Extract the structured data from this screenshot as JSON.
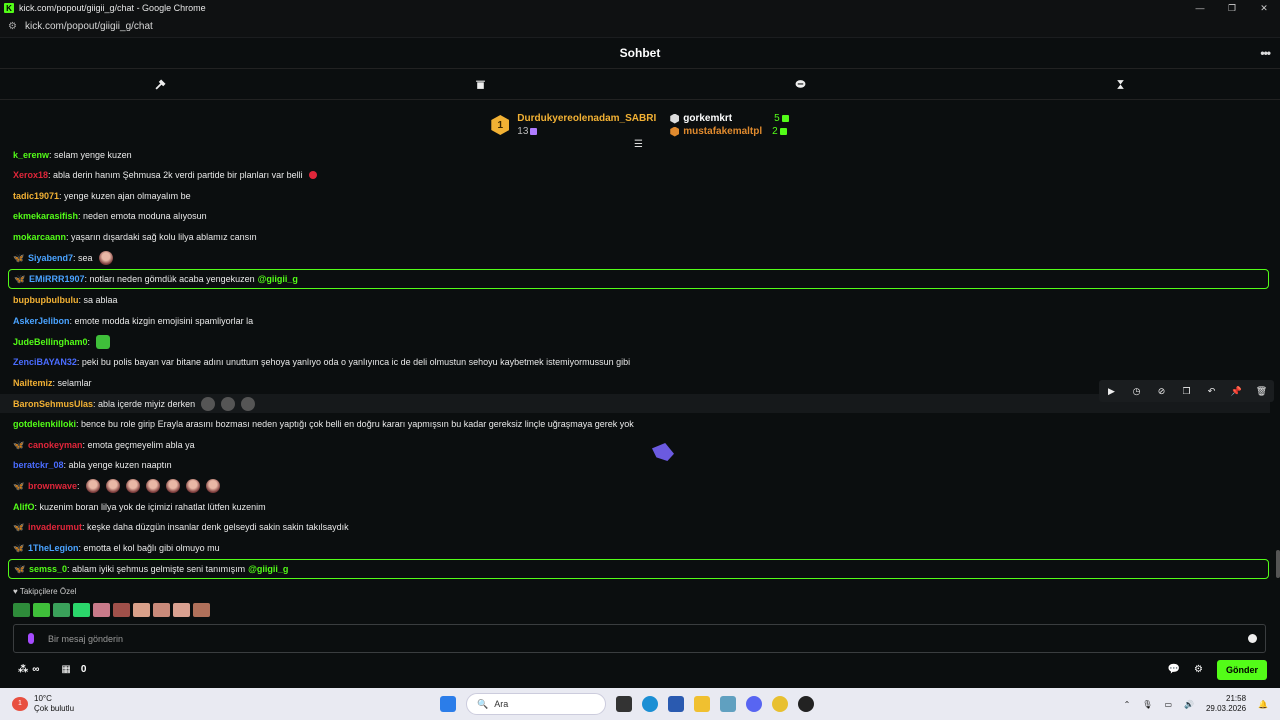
{
  "browser": {
    "title": "kick.com/popout/giigii_g/chat - Google Chrome",
    "url": "kick.com/popout/giigii_g/chat"
  },
  "header": {
    "title": "Sohbet",
    "more": "•••"
  },
  "leaderboard": {
    "first": {
      "name": "Durdukyereolenadam_SABRI",
      "count": "13",
      "rank": "1"
    },
    "second": {
      "name": "gorkemkrt",
      "count": "5"
    },
    "third": {
      "name": "mustafakemaltpl",
      "count": "2"
    }
  },
  "messages": [
    {
      "user": "k_erenw",
      "color": "#53fc18",
      "text": ": selam yenge kuzen"
    },
    {
      "user": "Xerox18",
      "color": "#e0263a",
      "text": ": abla derin hanım Şehmusa 2k verdi partide bir planları var belli"
    },
    {
      "user": "tadic19071",
      "color": "#f2b134",
      "text": ": yenge kuzen ajan olmayalım be"
    },
    {
      "user": "ekmekarasifish",
      "color": "#53fc18",
      "text": ": neden emota moduna alıyosun"
    },
    {
      "user": "mokarcaann",
      "color": "#53fc18",
      "text": ": yaşarın dışardaki sağ kolu lilya ablamız cansın"
    },
    {
      "user": "Siyabend7",
      "color": "#4aa3ff",
      "text": ": sea"
    },
    {
      "user": "EMiRRR1907",
      "color": "#4aa3ff",
      "text": ": notları neden gömdük acaba yengekuzen",
      "mention": "@giigii_g"
    },
    {
      "user": "bupbupbulbulu",
      "color": "#f2b134",
      "text": ": sa ablaa"
    },
    {
      "user": "AskerJelibon",
      "color": "#4aa3ff",
      "text": ": emote modda kizgin emojisini spamliyorlar la"
    },
    {
      "user": "JudeBellingham0",
      "color": "#53fc18",
      "text": ":"
    },
    {
      "user": "ZenciBAYAN32",
      "color": "#4a6cff",
      "text": ": peki bu polis bayan var bitane adını unuttum şehoya yanlıyo oda o yanlıyınca ic de deli olmustun sehoyu kaybetmek istemiyormussun gibi"
    },
    {
      "user": "Nailtemiz",
      "color": "#f2b134",
      "text": ": selamlar"
    },
    {
      "user": "BaronSehmusUlas",
      "color": "#f2b134",
      "text": ": abla içerde miyiz derken"
    },
    {
      "user": "gotdelenkilloki",
      "color": "#53fc18",
      "text": ": bence bu role girip Erayla arasını bozması neden yaptığı çok belli en doğru kararı yapmışsın bu kadar gereksiz linçle uğraşmaya gerek yok"
    },
    {
      "user": "canokeyman",
      "color": "#e0263a",
      "text": ": emota geçmeyelim abla ya"
    },
    {
      "user": "beratckr_08",
      "color": "#4a6cff",
      "text": ": abla yenge kuzen naaptın"
    },
    {
      "user": "brownwave",
      "color": "#e0263a",
      "text": ":"
    },
    {
      "user": "AlifO",
      "color": "#53fc18",
      "text": ": kuzenim boran lilya yok de içimizi rahatlat lütfen kuzenim"
    },
    {
      "user": "invaderumut",
      "color": "#e0263a",
      "text": ": keşke daha düzgün insanlar denk gelseydi sakin sakin takılsaydık"
    },
    {
      "user": "1TheLegion",
      "color": "#4aa3ff",
      "text": ": emotta el kol bağlı gibi olmuyo mu"
    },
    {
      "user": "semss_0",
      "color": "#53fc18",
      "text": ": ablam iyiki şehmus gelmişte seni tanımışım",
      "mention": "@giigii_g"
    }
  ],
  "followers_label": "Takipçilere Özel",
  "input": {
    "placeholder": "Bir mesaj gönderin"
  },
  "bottom": {
    "points": "0",
    "send": "Gönder",
    "infinity": "∞"
  },
  "taskbar": {
    "temp": "10°C",
    "weather": "Çok bulutlu",
    "search": "Ara",
    "time": "21:58",
    "date": "29.03.2026",
    "notif": "1"
  },
  "accent": "#53fc18"
}
